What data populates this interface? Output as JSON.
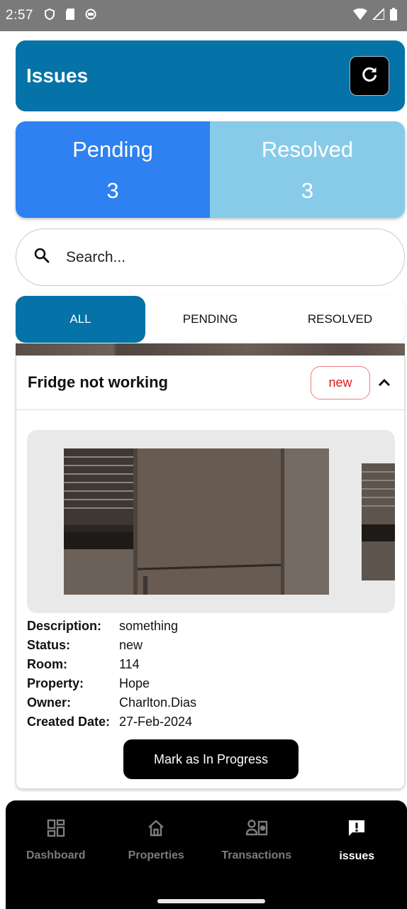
{
  "status_bar": {
    "time": "2:57"
  },
  "header": {
    "title": "Issues"
  },
  "summary": {
    "pending": {
      "label": "Pending",
      "count": "3"
    },
    "resolved": {
      "label": "Resolved",
      "count": "3"
    }
  },
  "search": {
    "placeholder": "Search..."
  },
  "tabs": [
    {
      "label": "ALL",
      "active": true
    },
    {
      "label": "PENDING",
      "active": false
    },
    {
      "label": "RESOLVED",
      "active": false
    }
  ],
  "issue": {
    "title": "Fridge not working",
    "badge": "new",
    "details": [
      {
        "key": "Description:",
        "value": "something"
      },
      {
        "key": "Status:",
        "value": "new"
      },
      {
        "key": "Room:",
        "value": "114"
      },
      {
        "key": "Property:",
        "value": "Hope"
      },
      {
        "key": "Owner:",
        "value": "Charlton.Dias"
      },
      {
        "key": "Created Date:",
        "value": "27-Feb-2024"
      }
    ],
    "action_label": "Mark as In Progress"
  },
  "bottom_nav": [
    {
      "label": "Dashboard",
      "icon": "dashboard-icon",
      "active": false
    },
    {
      "label": "Properties",
      "icon": "home-icon",
      "active": false
    },
    {
      "label": "Transactions",
      "icon": "transactions-icon",
      "active": false
    },
    {
      "label": "issues",
      "icon": "issue-icon",
      "active": true
    }
  ],
  "colors": {
    "primary": "#0572a8",
    "pending_card": "#2f80f0",
    "resolved_card": "#88cbe8",
    "badge_red": "#e31818"
  }
}
